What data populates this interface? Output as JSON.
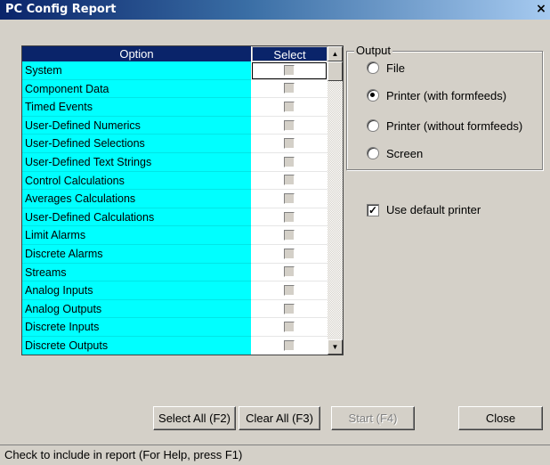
{
  "window": {
    "title": "PC Config Report",
    "close_glyph": "×"
  },
  "grid": {
    "headers": {
      "option": "Option",
      "select": "Select"
    },
    "rows": [
      {
        "label": "System",
        "checked": false
      },
      {
        "label": "Component Data",
        "checked": false
      },
      {
        "label": "Timed Events",
        "checked": false
      },
      {
        "label": "User-Defined Numerics",
        "checked": false
      },
      {
        "label": "User-Defined Selections",
        "checked": false
      },
      {
        "label": "User-Defined Text Strings",
        "checked": false
      },
      {
        "label": "Control Calculations",
        "checked": false
      },
      {
        "label": "Averages Calculations",
        "checked": false
      },
      {
        "label": "User-Defined Calculations",
        "checked": false
      },
      {
        "label": "Limit Alarms",
        "checked": false
      },
      {
        "label": "Discrete Alarms",
        "checked": false
      },
      {
        "label": "Streams",
        "checked": false
      },
      {
        "label": "Analog Inputs",
        "checked": false
      },
      {
        "label": "Analog Outputs",
        "checked": false
      },
      {
        "label": "Discrete Inputs",
        "checked": false
      },
      {
        "label": "Discrete Outputs",
        "checked": false
      }
    ],
    "scroll_up_glyph": "▲",
    "scroll_down_glyph": "▼"
  },
  "output": {
    "label": "Output",
    "options": [
      {
        "label": "File",
        "selected": false
      },
      {
        "label": "Printer (with formfeeds)",
        "selected": true
      },
      {
        "label": "Printer (without formfeeds)",
        "selected": false
      },
      {
        "label": "Screen",
        "selected": false
      }
    ]
  },
  "use_default_printer": {
    "label": "Use default printer",
    "checked": true,
    "check_glyph": "✓"
  },
  "buttons": {
    "select_all": "Select All (F2)",
    "clear_all": "Clear All (F3)",
    "start": "Start (F4)",
    "close": "Close"
  },
  "status": "Check to include in report (For Help, press F1)"
}
